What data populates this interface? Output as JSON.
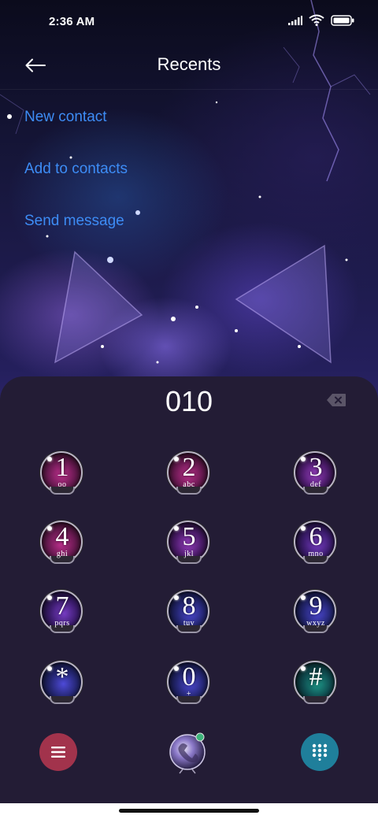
{
  "status_bar": {
    "time": "2:36 AM",
    "icons": [
      "signal-icon",
      "wifi-icon",
      "battery-icon"
    ]
  },
  "header": {
    "back_icon": "back-arrow-icon",
    "title": "Recents"
  },
  "actions": [
    {
      "label": "New contact"
    },
    {
      "label": "Add to contacts"
    },
    {
      "label": "Send message"
    }
  ],
  "dialer": {
    "number": "010",
    "backspace_icon": "backspace-icon",
    "keys": [
      {
        "digit": "1",
        "letters": "oo",
        "style": "pink"
      },
      {
        "digit": "2",
        "letters": "abc",
        "style": "pink"
      },
      {
        "digit": "3",
        "letters": "def",
        "style": "violet"
      },
      {
        "digit": "4",
        "letters": "ghi",
        "style": "pink"
      },
      {
        "digit": "5",
        "letters": "jkl",
        "style": "violet"
      },
      {
        "digit": "6",
        "letters": "mno",
        "style": "purple"
      },
      {
        "digit": "7",
        "letters": "pqrs",
        "style": "purple"
      },
      {
        "digit": "8",
        "letters": "tuv",
        "style": "blue"
      },
      {
        "digit": "9",
        "letters": "wxyz",
        "style": "blue"
      },
      {
        "digit": "*",
        "letters": "",
        "style": "blue"
      },
      {
        "digit": "0",
        "letters": "+",
        "style": "blue"
      },
      {
        "digit": "#",
        "letters": "",
        "style": "teal"
      }
    ]
  },
  "bottom_bar": {
    "menu_icon": "menu-icon",
    "call_icon": "call-orb-icon",
    "keypad_icon": "keypad-icon",
    "colors": {
      "menu": "#a2334c",
      "keypad": "#1f7f9b",
      "link": "#3d8cf5",
      "panel": "#231c35"
    }
  }
}
